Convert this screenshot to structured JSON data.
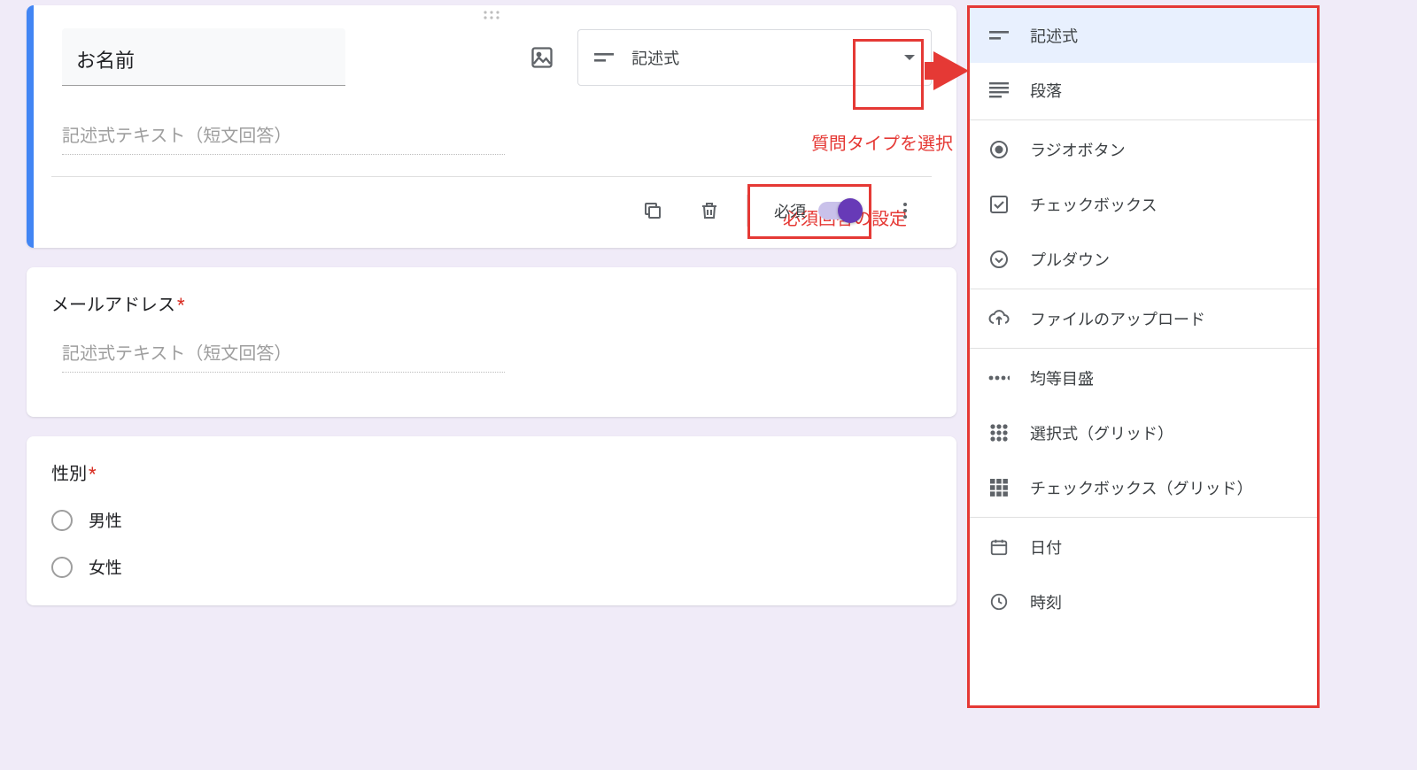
{
  "card1": {
    "title_value": "お名前",
    "type_label": "記述式",
    "answer_placeholder": "記述式テキスト（短文回答）",
    "required_label": "必須"
  },
  "card2": {
    "title": "メールアドレス",
    "answer_placeholder": "記述式テキスト（短文回答）"
  },
  "card3": {
    "title": "性別",
    "options": [
      "男性",
      "女性"
    ]
  },
  "annotations": {
    "select_type": "質問タイプを選択",
    "required_setting": "必須回答の設定"
  },
  "dropdown": {
    "items": [
      {
        "label": "記述式",
        "icon": "short-text",
        "selected": true
      },
      {
        "label": "段落",
        "icon": "paragraph"
      },
      {
        "sep": true
      },
      {
        "label": "ラジオボタン",
        "icon": "radio"
      },
      {
        "label": "チェックボックス",
        "icon": "checkbox"
      },
      {
        "label": "プルダウン",
        "icon": "dropdown"
      },
      {
        "sep": true
      },
      {
        "label": "ファイルのアップロード",
        "icon": "upload"
      },
      {
        "sep": true
      },
      {
        "label": "均等目盛",
        "icon": "linear"
      },
      {
        "label": "選択式（グリッド）",
        "icon": "grid-radio"
      },
      {
        "label": "チェックボックス（グリッド）",
        "icon": "grid-check"
      },
      {
        "sep": true
      },
      {
        "label": "日付",
        "icon": "date"
      },
      {
        "label": "時刻",
        "icon": "time"
      }
    ]
  }
}
